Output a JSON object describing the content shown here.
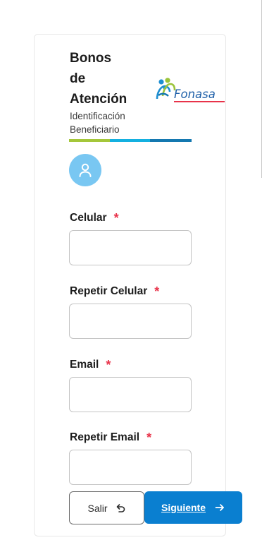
{
  "header": {
    "title_lines": [
      "Bonos",
      "de",
      "Atención"
    ],
    "subtitle_lines": [
      "Identificación",
      "Beneficiario"
    ],
    "logo_text": "Fonasa"
  },
  "progress": {
    "colors": [
      "#a4c73a",
      "#14b0e0",
      "#1478b0"
    ]
  },
  "avatar": {
    "icon": "user-icon",
    "color": "#79c7f2"
  },
  "form": {
    "required_mark": "*",
    "fields": [
      {
        "label": "Celular",
        "value": "",
        "placeholder": ""
      },
      {
        "label": "Repetir Celular",
        "value": "",
        "placeholder": ""
      },
      {
        "label": "Email",
        "value": "",
        "placeholder": ""
      },
      {
        "label": "Repetir Email",
        "value": "",
        "placeholder": ""
      }
    ]
  },
  "actions": {
    "exit_label": "Salir",
    "exit_icon": "undo-arrow-icon",
    "next_label": "Siguiente",
    "next_icon": "arrow-right-icon"
  },
  "colors": {
    "primary": "#0a7fd0",
    "required": "#e8334a",
    "text": "#1c1c1c"
  }
}
